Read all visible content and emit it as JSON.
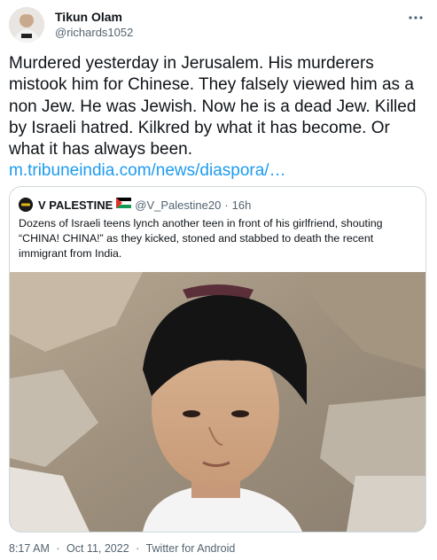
{
  "tweet": {
    "display_name": "Tikun Olam",
    "handle": "@richards1052",
    "text": "Murdered yesterday in Jerusalem. His murderers mistook him for Chinese. They falsely viewed him as a non Jew. He was Jewish. Now he is a dead Jew. Killed by Israeli hatred. Kilkred by what it has become. Or what it has always been.",
    "link": "m.tribuneindia.com/news/diaspora/…",
    "more_icon": "more-horizontal-icon"
  },
  "quote": {
    "display_name": "V PALESTINE",
    "flag_icon": "palestine-flag-icon",
    "handle": "@V_Palestine20",
    "separator": "·",
    "time": "16h",
    "text": "Dozens of Israeli teens lynch another teen in front of his girlfriend, shouting “CHINA! CHINA!” as they kicked, stoned and stabbed to death the recent immigrant from India."
  },
  "footer": {
    "time": "8:17 AM",
    "date": "Oct 11, 2022",
    "separator": "·",
    "source": "Twitter for Android"
  },
  "colors": {
    "text": "#0f1419",
    "secondary": "#536471",
    "link": "#1d9bf0",
    "border": "#cfd9de"
  }
}
